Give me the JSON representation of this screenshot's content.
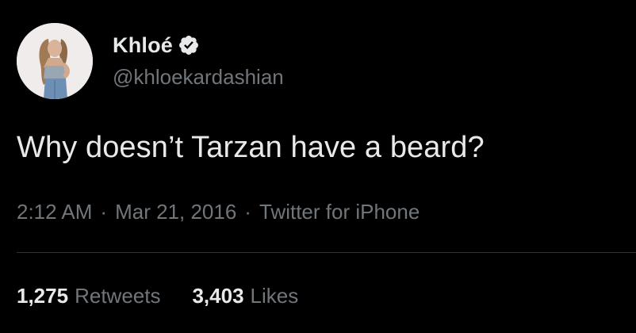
{
  "user": {
    "display_name": "Khloé",
    "handle": "@khloekardashian",
    "verified_icon": "verified-badge-icon",
    "verified_color": "#e7e9ea"
  },
  "tweet": {
    "text": "Why doesn’t Tarzan have a beard?",
    "time": "2:12 AM",
    "separator": "·",
    "date": "Mar 21, 2016",
    "source": "Twitter for iPhone"
  },
  "stats": {
    "retweets_count": "1,275",
    "retweets_label": "Retweets",
    "likes_count": "3,403",
    "likes_label": "Likes"
  },
  "colors": {
    "background": "#000000",
    "primary_text": "#e7e9ea",
    "secondary_text": "#71767b",
    "divider": "#2f3336"
  }
}
